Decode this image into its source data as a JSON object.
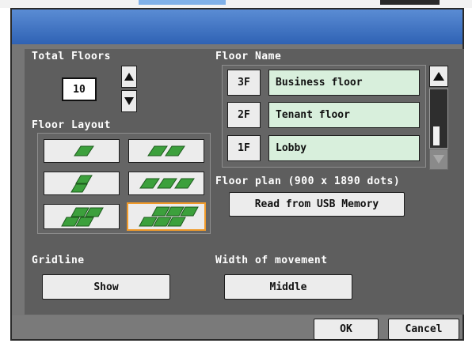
{
  "dialog": {
    "total_floors_label": "Total Floors",
    "total_floors_value": "10",
    "floor_layout_label": "Floor Layout",
    "floor_name_label": "Floor Name",
    "floors": [
      {
        "number": "3F",
        "name": "Business floor"
      },
      {
        "number": "2F",
        "name": "Tenant floor"
      },
      {
        "number": "1F",
        "name": "Lobby"
      }
    ],
    "floor_plan_label": "Floor plan (900 x 1890 dots)",
    "read_usb_label": "Read from USB Memory",
    "gridline_label": "Gridline",
    "gridline_value": "Show",
    "width_label": "Width of movement",
    "width_value": "Middle",
    "ok_label": "OK",
    "cancel_label": "Cancel",
    "selected_layout_index": 5,
    "colors": {
      "title_bar": "#3a6fc0",
      "dialog_bg": "#767676",
      "field_green": "#d8efdc",
      "tile_green": "#3ca03c",
      "selection": "#f09a2a"
    }
  }
}
